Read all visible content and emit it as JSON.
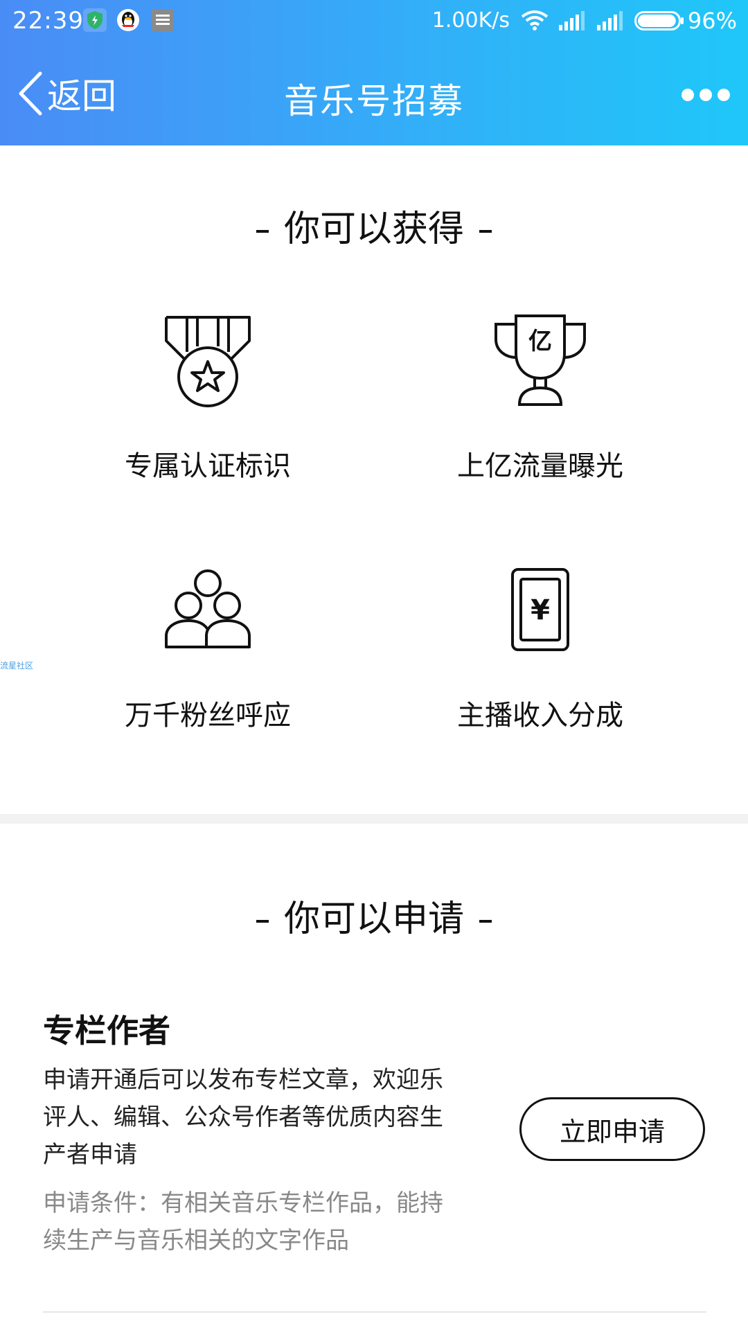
{
  "status_bar": {
    "time": "22:39",
    "net_speed": "1.00K/s",
    "battery_percent": "96%",
    "battery_level": 0.96,
    "icons": [
      "shield-icon",
      "qq-icon",
      "app-icon",
      "wifi-icon",
      "signal-icon",
      "signal-icon",
      "battery-icon"
    ]
  },
  "nav": {
    "back_label": "返回",
    "title": "音乐号招募",
    "more_icon": "more-dots-icon"
  },
  "benefits_section": {
    "heading": "你可以获得",
    "items": [
      {
        "icon": "medal-icon",
        "label": "专属认证标识"
      },
      {
        "icon": "trophy-icon",
        "trophy_text": "亿",
        "label": "上亿流量曝光"
      },
      {
        "icon": "fans-icon",
        "label": "万千粉丝呼应"
      },
      {
        "icon": "money-card-icon",
        "card_text": "¥",
        "label": "主播收入分成"
      }
    ]
  },
  "watermark": "流星社区",
  "apply_section": {
    "heading": "你可以申请",
    "items": [
      {
        "title": "专栏作者",
        "description": "申请开通后可以发布专栏文章，欢迎乐评人、编辑、公众号作者等优质内容生产者申请",
        "conditions": "申请条件：有相关音乐专栏作品，能持续生产与音乐相关的文字作品",
        "button_label": "立即申请"
      }
    ]
  },
  "colors": {
    "header_gradient_start": "#4a8cf6",
    "header_gradient_end": "#1fc7f9",
    "text_primary": "#111111",
    "text_secondary": "#888888"
  }
}
